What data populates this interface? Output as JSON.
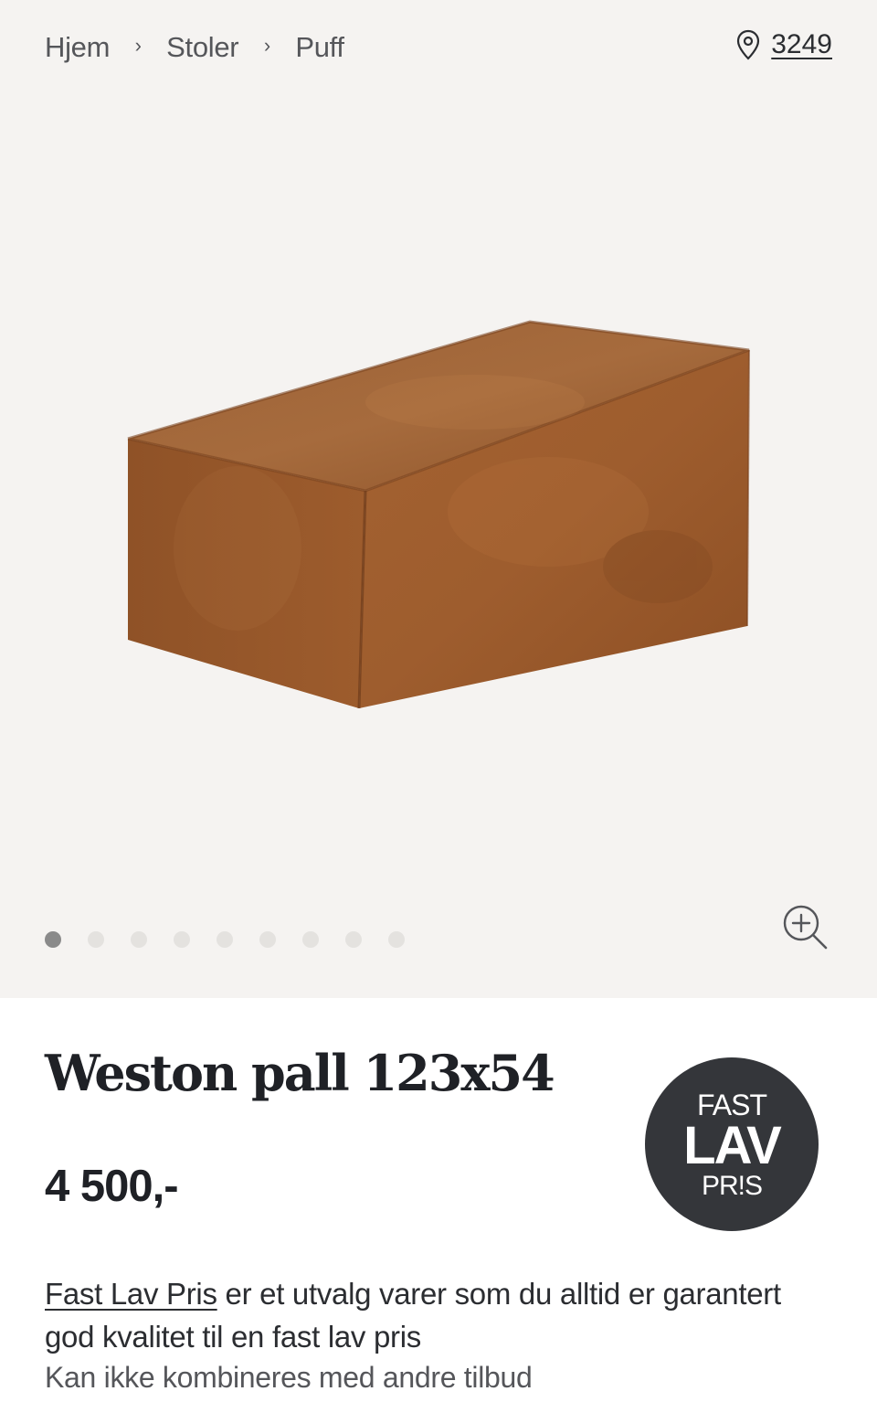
{
  "breadcrumb": {
    "items": [
      "Hjem",
      "Stoler",
      "Puff"
    ],
    "separator": "›"
  },
  "store": {
    "icon": "location-pin-icon",
    "number": "3249"
  },
  "gallery": {
    "slide_count": 9,
    "active_index": 0,
    "zoom_icon": "zoom-in-icon",
    "background": "#f5f3f1"
  },
  "product": {
    "title": "Weston pall 123x54",
    "price": "4 500,-",
    "color": "#9a5a2c"
  },
  "badge": {
    "line1": "FAST",
    "line2": "LAV",
    "line3": "PR!S",
    "color": "#34363a"
  },
  "description": {
    "link": "Fast Lav Pris",
    "text": " er et utvalg varer som du alltid er garantert god kvalitet til en fast lav pris",
    "note": "Kan ikke kombineres med andre tilbud"
  }
}
